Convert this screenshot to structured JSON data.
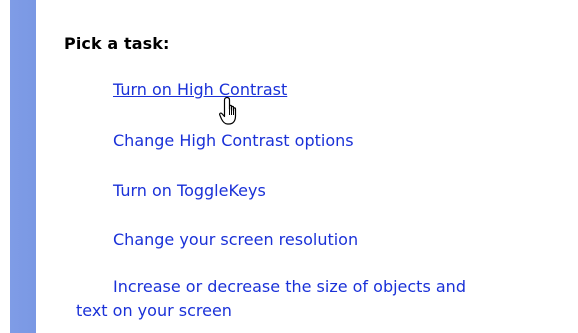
{
  "panel": {
    "heading": "Pick a task:",
    "tasks": [
      {
        "label": "Turn on High Contrast",
        "state": "hovered"
      },
      {
        "label": "Change High Contrast options"
      },
      {
        "label": "Turn on ToggleKeys"
      },
      {
        "label": "Change your screen resolution"
      },
      {
        "label": "Increase or decrease the size of objects and text on your screen"
      }
    ]
  },
  "colors": {
    "link": "#1a31d8",
    "sidebar": "#7a98e4"
  },
  "cursor_icon": "hand-pointer-icon"
}
